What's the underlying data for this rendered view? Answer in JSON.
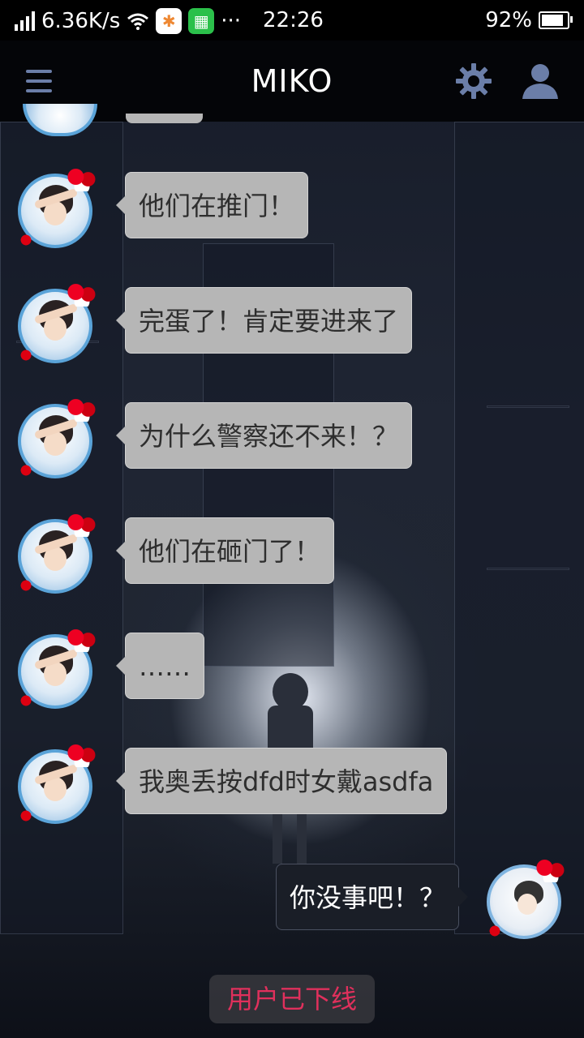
{
  "status_bar": {
    "net_speed": "6.36K/s",
    "time": "22:26",
    "battery": "92%",
    "more": "···"
  },
  "nav": {
    "title": "MIKO",
    "menu_icon": "menu-icon",
    "settings_icon": "gear-icon",
    "profile_icon": "user-icon"
  },
  "messages": [
    {
      "from": "miko",
      "text": "他们在推门！"
    },
    {
      "from": "miko",
      "text": "完蛋了！肯定要进来了"
    },
    {
      "from": "miko",
      "text": "为什么警察还不来！？"
    },
    {
      "from": "miko",
      "text": "他们在砸门了！"
    },
    {
      "from": "miko",
      "text": "……"
    },
    {
      "from": "miko",
      "text": "我奥丢按dfd时女戴asdfa"
    },
    {
      "from": "me",
      "text": "你没事吧！？"
    }
  ],
  "system_notice": "用户已下线",
  "colors": {
    "incoming_bubble": "#b6b6b6",
    "outgoing_bubble": "#1a1e27",
    "notice_text": "#e0305c",
    "icon_accent": "#6b7ea8"
  }
}
